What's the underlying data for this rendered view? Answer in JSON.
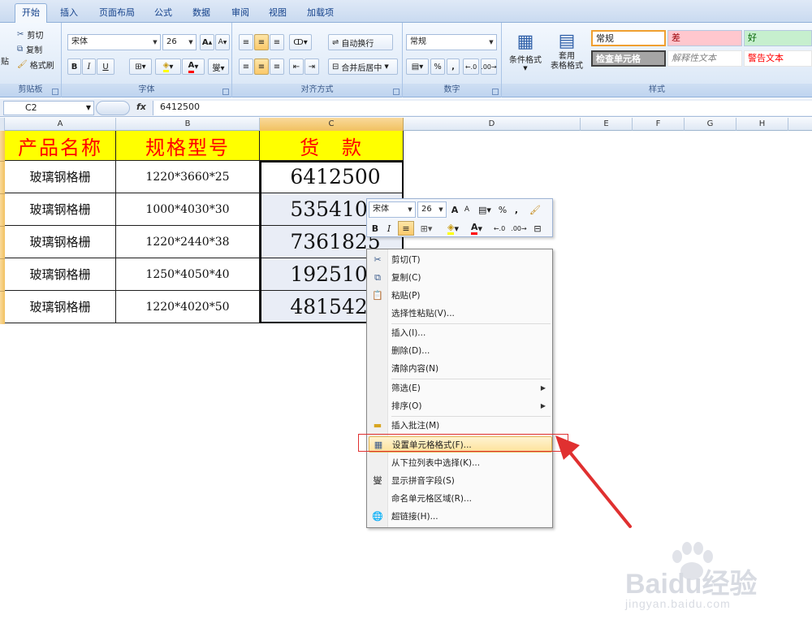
{
  "tabs": [
    "开始",
    "插入",
    "页面布局",
    "公式",
    "数据",
    "审阅",
    "视图",
    "加载项"
  ],
  "ribbon": {
    "clipboard": {
      "paste": "贴",
      "cut": "剪切",
      "copy": "复制",
      "format_painter": "格式刷",
      "label": "剪贴板"
    },
    "font": {
      "name": "宋体",
      "size": "26",
      "label": "字体",
      "bold": "B",
      "italic": "I",
      "underline": "U"
    },
    "alignment": {
      "wrap": "自动换行",
      "merge": "合并后居中",
      "label": "对齐方式"
    },
    "number": {
      "format": "常规",
      "percent": "%",
      "comma": ",",
      "label": "数字"
    },
    "styles": {
      "conditional": "条件格式",
      "table_format_1": "套用",
      "table_format_2": "表格格式",
      "normal": "常规",
      "bad": "差",
      "good": "好",
      "check_cell": "检查单元格",
      "explanatory": "解释性文本",
      "warning": "警告文本",
      "label": "样式"
    }
  },
  "formula_bar": {
    "name_box": "C2",
    "fx": "fx",
    "value": "6412500"
  },
  "columns": [
    "A",
    "B",
    "C",
    "D",
    "E",
    "F",
    "G",
    "H"
  ],
  "table": {
    "headers": [
      "产品名称",
      "规格型号",
      "货　款"
    ],
    "rows": [
      {
        "name": "玻璃钢格栅",
        "spec": "1220*3660*25",
        "amount": "6412500"
      },
      {
        "name": "玻璃钢格栅",
        "spec": "1000*4030*30",
        "amount": "5354100"
      },
      {
        "name": "玻璃钢格栅",
        "spec": "1220*2440*38",
        "amount": "7361825"
      },
      {
        "name": "玻璃钢格栅",
        "spec": "1250*4050*40",
        "amount": "1925100"
      },
      {
        "name": "玻璃钢格栅",
        "spec": "1220*4020*50",
        "amount": "4815425"
      }
    ]
  },
  "mini_toolbar": {
    "font": "宋体",
    "size": "26",
    "bold": "B",
    "italic": "I",
    "percent": "%",
    "comma": ","
  },
  "context_menu": {
    "cut": "剪切(T)",
    "copy": "复制(C)",
    "paste": "粘贴(P)",
    "paste_special": "选择性粘贴(V)...",
    "insert": "插入(I)...",
    "delete": "删除(D)...",
    "clear": "清除内容(N)",
    "filter": "筛选(E)",
    "sort": "排序(O)",
    "comment": "插入批注(M)",
    "format_cells": "设置单元格格式(F)...",
    "pick_list": "从下拉列表中选择(K)...",
    "phonetic": "显示拼音字段(S)",
    "name_range": "命名单元格区域(R)...",
    "hyperlink": "超链接(H)..."
  },
  "watermark": {
    "brand": "Baidu经验",
    "url": "jingyan.baidu.com"
  },
  "colors": {
    "header_fill": "#ffff00",
    "header_text": "#ff0000",
    "arrow": "#e03030",
    "highlight": "#fde29a"
  }
}
